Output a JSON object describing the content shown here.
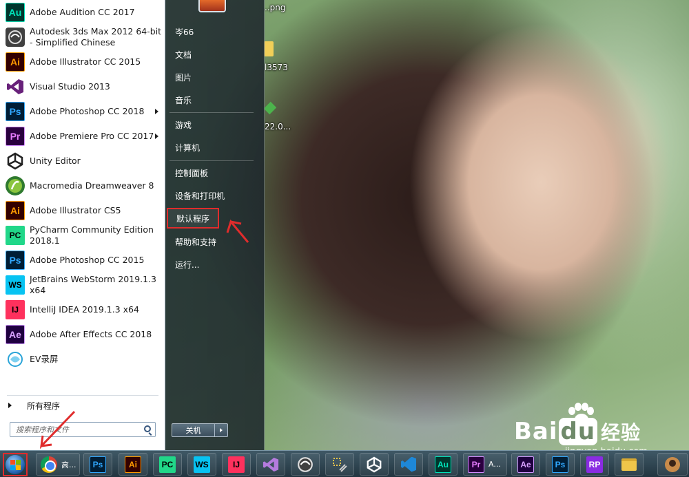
{
  "desktop": {
    "labels": [
      "..png",
      "l3573",
      "22.0..."
    ],
    "watermark": {
      "brand_left": "Bai",
      "brand_du": "du",
      "brand_cn": "经验",
      "url": "jingyan.baidu.com"
    }
  },
  "start_menu": {
    "programs": [
      {
        "icon": "adobe-audition-icon",
        "icon_text": "Au",
        "label": "Adobe Audition CC 2017",
        "submenu": false
      },
      {
        "icon": "3ds-max-icon",
        "icon_text": "",
        "label": "Autodesk 3ds Max 2012 64-bit",
        "label2": "- Simplified Chinese",
        "submenu": false
      },
      {
        "icon": "adobe-illustrator-icon",
        "icon_text": "Ai",
        "label": "Adobe Illustrator CC 2015",
        "submenu": false
      },
      {
        "icon": "visual-studio-icon",
        "icon_text": "",
        "label": "Visual Studio 2013",
        "submenu": false
      },
      {
        "icon": "adobe-photoshop-icon",
        "icon_text": "Ps",
        "label": "Adobe Photoshop CC 2018",
        "submenu": true
      },
      {
        "icon": "adobe-premiere-icon",
        "icon_text": "Pr",
        "label": "Adobe Premiere Pro CC 2017",
        "submenu": true
      },
      {
        "icon": "unity-icon",
        "icon_text": "",
        "label": "Unity Editor",
        "submenu": false
      },
      {
        "icon": "dreamweaver-icon",
        "icon_text": "",
        "label": "Macromedia Dreamweaver 8",
        "submenu": false
      },
      {
        "icon": "adobe-illustrator-icon",
        "icon_text": "Ai",
        "label": "Adobe Illustrator CS5",
        "submenu": false
      },
      {
        "icon": "pycharm-icon",
        "icon_text": "PC",
        "label": "PyCharm Community Edition",
        "label2": "2018.1",
        "submenu": false
      },
      {
        "icon": "adobe-photoshop-icon",
        "icon_text": "Ps",
        "label": "Adobe Photoshop CC 2015",
        "submenu": false
      },
      {
        "icon": "webstorm-icon",
        "icon_text": "WS",
        "label": "JetBrains WebStorm 2019.1.3",
        "label2": "x64",
        "submenu": false
      },
      {
        "icon": "intellij-icon",
        "icon_text": "IJ",
        "label": "IntelliJ IDEA 2019.1.3 x64",
        "submenu": false
      },
      {
        "icon": "adobe-after-effects-icon",
        "icon_text": "Ae",
        "label": "Adobe After Effects CC 2018",
        "submenu": false
      },
      {
        "icon": "ev-recorder-icon",
        "icon_text": "",
        "label": "EV录屏",
        "submenu": false
      }
    ],
    "all_programs_label": "所有程序",
    "search_placeholder": "搜索程序和文件",
    "right_items": [
      {
        "key": "user",
        "label": "岑66"
      },
      {
        "key": "documents",
        "label": "文档"
      },
      {
        "key": "pictures",
        "label": "图片"
      },
      {
        "key": "music",
        "label": "音乐"
      },
      {
        "key": "games",
        "label": "游戏"
      },
      {
        "key": "computer",
        "label": "计算机"
      },
      {
        "key": "control-panel",
        "label": "控制面板"
      },
      {
        "key": "devices-printers",
        "label": "设备和打印机"
      },
      {
        "key": "default-programs",
        "label": "默认程序"
      },
      {
        "key": "help-support",
        "label": "帮助和支持"
      },
      {
        "key": "run",
        "label": "运行..."
      }
    ],
    "shutdown_label": "关机"
  },
  "taskbar": {
    "items": [
      {
        "key": "chrome",
        "icon_text": "",
        "label": "高..."
      },
      {
        "key": "photoshop",
        "icon_text": "Ps",
        "label": ""
      },
      {
        "key": "illustrator",
        "icon_text": "Ai",
        "label": ""
      },
      {
        "key": "pycharm",
        "icon_text": "PC",
        "label": ""
      },
      {
        "key": "webstorm",
        "icon_text": "WS",
        "label": ""
      },
      {
        "key": "intellij",
        "icon_text": "IJ",
        "label": ""
      },
      {
        "key": "visual-studio",
        "icon_text": "",
        "label": ""
      },
      {
        "key": "3ds-max",
        "icon_text": "",
        "label": ""
      },
      {
        "key": "tools",
        "icon_text": "",
        "label": ""
      },
      {
        "key": "unity",
        "icon_text": "",
        "label": ""
      },
      {
        "key": "vscode",
        "icon_text": "",
        "label": ""
      },
      {
        "key": "audition",
        "icon_text": "Au",
        "label": ""
      },
      {
        "key": "premiere",
        "icon_text": "Pr",
        "label": "A..."
      },
      {
        "key": "after-effects",
        "icon_text": "Ae",
        "label": ""
      },
      {
        "key": "photoshop-2",
        "icon_text": "Ps",
        "label": ""
      },
      {
        "key": "axure",
        "icon_text": "RP",
        "label": ""
      },
      {
        "key": "explorer",
        "icon_text": "",
        "label": ""
      }
    ]
  },
  "colors": {
    "highlight_box": "#e02c2c",
    "start_menu_left_bg": "#ffffff",
    "taskbar_bg": "#223540"
  }
}
